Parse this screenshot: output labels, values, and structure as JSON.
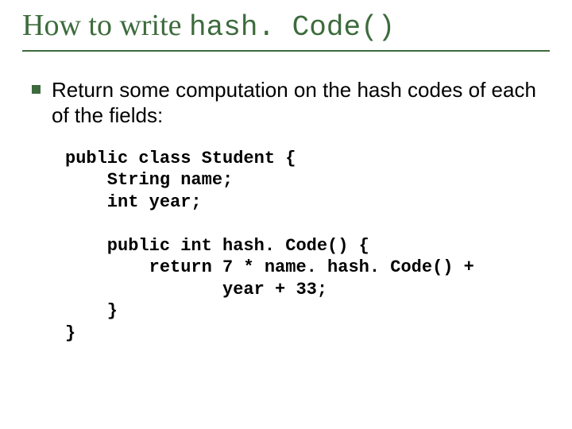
{
  "title": {
    "prefix": "How to write ",
    "code": "hash. Code()"
  },
  "bullet": {
    "text": "Return some computation on the hash codes of each of the fields:"
  },
  "code": {
    "line1": "public class Student {",
    "line2": "    String name;",
    "line3": "    int year;",
    "line4": "",
    "line5": "    public int hash. Code() {",
    "line6": "        return 7 * name. hash. Code() +",
    "line7": "               year + 33;",
    "line8": "    }",
    "line9": "}"
  }
}
